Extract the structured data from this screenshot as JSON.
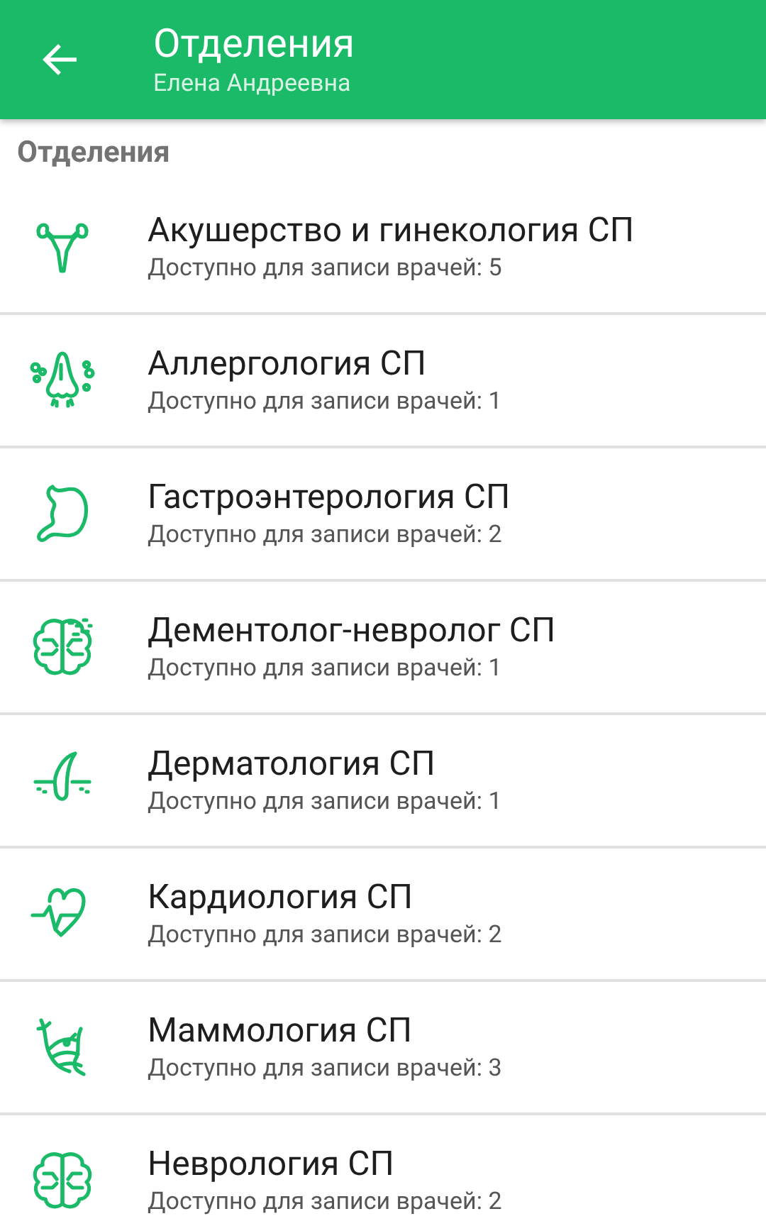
{
  "app_bar": {
    "title": "Отделения",
    "subtitle": "Елена Андреевна"
  },
  "section_title": "Отделения",
  "departments": [
    {
      "name": "Акушерство и гинекология СП",
      "availability": "Доступно для записи врачей: 5"
    },
    {
      "name": "Аллергология СП",
      "availability": "Доступно для записи врачей: 1"
    },
    {
      "name": "Гастроэнтерология СП",
      "availability": "Доступно для записи врачей: 2"
    },
    {
      "name": "Дементолог-невролог СП",
      "availability": "Доступно для записи врачей: 1"
    },
    {
      "name": "Дерматология СП",
      "availability": "Доступно для записи врачей: 1"
    },
    {
      "name": "Кардиология СП",
      "availability": "Доступно для записи врачей: 2"
    },
    {
      "name": "Маммология СП",
      "availability": "Доступно для записи врачей: 3"
    },
    {
      "name": "Неврология СП",
      "availability": "Доступно для записи врачей: 2"
    }
  ]
}
